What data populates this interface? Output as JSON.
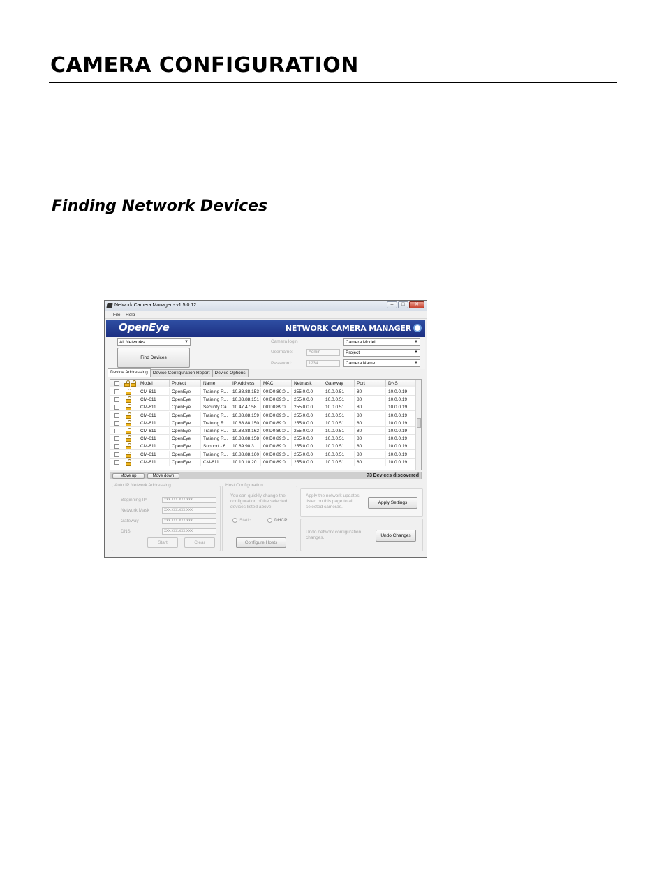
{
  "page": {
    "title": "CAMERA CONFIGURATION",
    "section_title": "Finding Network Devices"
  },
  "window": {
    "title": "Network Camera Manager - v1.5.0.12",
    "menu": [
      "File",
      "Help"
    ],
    "logo": "OpenEye",
    "banner_title": "NETWORK CAMERA MANAGER",
    "network_select": "All Networks",
    "find_button": "Find Devices",
    "camera_login_label": "Camera login",
    "username_label": "Username:",
    "username_value": "Admin",
    "password_label": "Password:",
    "password_value": "1234",
    "filters": [
      "Camera Model",
      "Project",
      "Camera Name"
    ],
    "tabs": [
      "Device Addressing",
      "Device Configuration Report",
      "Device Options"
    ],
    "columns": [
      "Model",
      "Project",
      "Name",
      "IP Address",
      "MAC",
      "Netmask",
      "Gateway",
      "Port",
      "DNS"
    ],
    "rows": [
      [
        "CM-611",
        "OpenEye",
        "Training R...",
        "10.88.88.153",
        "00:D0:89:0...",
        "255.0.0.0",
        "10.0.0.51",
        "80",
        "10.0.0.19"
      ],
      [
        "CM-611",
        "OpenEye",
        "Training R...",
        "10.88.88.151",
        "00:D0:89:0...",
        "255.0.0.0",
        "10.0.0.51",
        "80",
        "10.0.0.19"
      ],
      [
        "CM-611",
        "OpenEye",
        "Security Ca...",
        "10.47.47.58",
        "00:D0:89:0...",
        "255.0.0.0",
        "10.0.0.51",
        "80",
        "10.0.0.19"
      ],
      [
        "CM-611",
        "OpenEye",
        "Training R...",
        "10.88.88.159",
        "00:D0:89:0...",
        "255.0.0.0",
        "10.0.0.51",
        "80",
        "10.0.0.19"
      ],
      [
        "CM-611",
        "OpenEye",
        "Training R...",
        "10.88.88.150",
        "00:D0:89:0...",
        "255.0.0.0",
        "10.0.0.51",
        "80",
        "10.0.0.19"
      ],
      [
        "CM-611",
        "OpenEye",
        "Training R...",
        "10.88.88.162",
        "00:D0:89:0...",
        "255.0.0.0",
        "10.0.0.51",
        "80",
        "10.0.0.19"
      ],
      [
        "CM-611",
        "OpenEye",
        "Training R...",
        "10.88.88.158",
        "00:D0:89:0...",
        "255.0.0.0",
        "10.0.0.51",
        "80",
        "10.0.0.19"
      ],
      [
        "CM-611",
        "OpenEye",
        "Support - 6...",
        "10.89.90.3",
        "00:D0:89:0...",
        "255.0.0.0",
        "10.0.0.51",
        "80",
        "10.0.0.19"
      ],
      [
        "CM-611",
        "OpenEye",
        "Training R...",
        "10.88.88.160",
        "00:D0:89:0...",
        "255.0.0.0",
        "10.0.0.51",
        "80",
        "10.0.0.19"
      ],
      [
        "CM-611",
        "OpenEye",
        "CM-611",
        "10.10.10.20",
        "00:D0:89:0...",
        "255.0.0.0",
        "10.0.0.51",
        "80",
        "10.0.0.19"
      ]
    ],
    "move_up": "Move up",
    "move_down": "Move down",
    "device_count": "73",
    "devices_label": "Devices discovered",
    "auto_ip_title": "Auto IP Network Addressing",
    "auto_ip_labels": [
      "Beginning IP",
      "Network Mask",
      "Gateway",
      "DNS"
    ],
    "auto_ip_placeholder": "xxx.xxx.xxx.xxx",
    "start_button": "Start",
    "clear_button": "Clear",
    "host_title": "Host Configuration",
    "host_text": "You can quickly change the configuration of the selected devices listed above.",
    "static_label": "Static",
    "dhcp_label": "DHCP",
    "configure_button": "Configure Hosts",
    "apply_text": "Apply the network updates listed on this page to all selected cameras.",
    "apply_button": "Apply Settings",
    "undo_text": "Undo network configuration changes.",
    "undo_button": "Undo Changes"
  }
}
